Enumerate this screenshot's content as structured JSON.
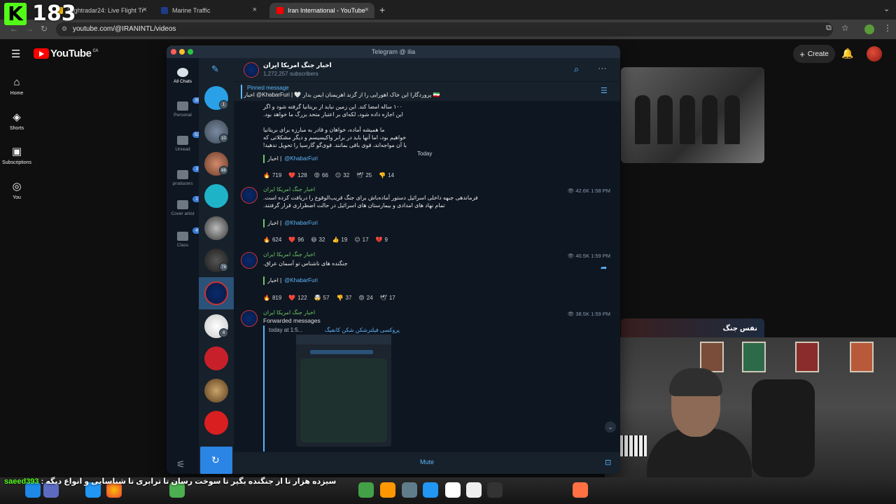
{
  "stream": {
    "kick_letter": "K",
    "viewer_count": "183"
  },
  "browser": {
    "tabs": [
      {
        "label": "Flightradar24: Live Flight Tra",
        "active": false
      },
      {
        "label": "Marine Traffic",
        "active": false
      },
      {
        "label": "Iran International - YouTube",
        "active": true
      }
    ],
    "new_tab": "+",
    "url": "youtube.com/@IRANINTL/videos"
  },
  "youtube": {
    "logo": "YouTube",
    "country": "CA",
    "create_label": "Create",
    "nav": [
      {
        "label": "Home",
        "icon": "home-icon"
      },
      {
        "label": "Shorts",
        "icon": "shorts-icon"
      },
      {
        "label": "Subscriptions",
        "icon": "subscriptions-icon"
      },
      {
        "label": "You",
        "icon": "you-icon"
      }
    ],
    "thumb2_title": "نفس جنگ"
  },
  "telegram": {
    "window_title": "Telegram @ ilia",
    "folders": [
      {
        "label": "All Chats",
        "badge": ""
      },
      {
        "label": "Personal",
        "badge": "395"
      },
      {
        "label": "Unread",
        "badge": "535"
      },
      {
        "label": "producers",
        "badge": "3"
      },
      {
        "label": "Cover artist",
        "badge": "1"
      },
      {
        "label": "Class",
        "badge": "4"
      }
    ],
    "chat_badges": [
      "1",
      "10",
      "88",
      "78",
      "4"
    ],
    "channel": {
      "title": "اخبار جنگ امریکا ایران",
      "subscribers": "1,272,257 subscribers"
    },
    "pinned": {
      "label": "Pinned message",
      "text": "🇮🇷 پروردگارا این خاک اهورایی را از گزند اهریمنان ایمن بدار 🤍 | KhabarFuri@ اخبار"
    },
    "date_separator": "Today",
    "messages": [
      {
        "text_lines": [
          "۱۰۰ ساله امضا کند. این زمین نباید از بریتانیا گرفته شود و اگر",
          "این اجازه داده شود، لکه‌ای بر اعتبار متحد بزرگ ما خواهد بود.",
          "",
          "ما همیشه آماده، خواهان و قادر به مبارزه برای بریتانیا",
          "خواهیم بود، اما آنها باید در برابر واکیسیسم و دیگر مشکلاتی که",
          "با آن مواجه‌اند، قوی باقی بمانند. قوی‌گو گارسیا را تحویل ندهید!"
        ],
        "signature": {
          "label": "اخبار |",
          "handle": "@KhabarFuri"
        },
        "reactions": [
          {
            "emoji": "🔥",
            "count": "719"
          },
          {
            "emoji": "❤️",
            "count": "128"
          },
          {
            "emoji": "😡",
            "count": "66"
          },
          {
            "emoji": "😐",
            "count": "32"
          },
          {
            "emoji": "🕊",
            "count": "25"
          },
          {
            "emoji": "👎",
            "count": "14"
          }
        ]
      },
      {
        "author": "اخبار جنگ امریکا ایران",
        "views": "42.6K",
        "time": "1:58 PM",
        "text_lines": [
          "فرماندهی جبهه داخلی اسرائیل دستور آماده‌باش برای جنگ قریب‌الوقوع را دریافت کرده است.",
          "تمام نهاد های امدادی و بیمارستان های اسرائیل در حالت اضطراری قرار گرفتند."
        ],
        "signature": {
          "label": "اخبار |",
          "handle": "@KhabarFuri"
        },
        "reactions": [
          {
            "emoji": "🔥",
            "count": "624"
          },
          {
            "emoji": "❤️",
            "count": "96"
          },
          {
            "emoji": "😄",
            "count": "32"
          },
          {
            "emoji": "👍",
            "count": "19"
          },
          {
            "emoji": "😐",
            "count": "17"
          },
          {
            "emoji": "💔",
            "count": "9"
          }
        ]
      },
      {
        "author": "اخبار جنگ امریکا ایران",
        "views": "40.5K",
        "time": "1:59 PM",
        "text_lines": [
          "جنگنده های ناشناس تو آسمان عراق."
        ],
        "signature": {
          "label": "اخبار |",
          "handle": "@KhabarFuri"
        },
        "reactions": [
          {
            "emoji": "🔥",
            "count": "819"
          },
          {
            "emoji": "❤️",
            "count": "122"
          },
          {
            "emoji": "🤯",
            "count": "57"
          },
          {
            "emoji": "👎",
            "count": "37"
          },
          {
            "emoji": "😡",
            "count": "24"
          },
          {
            "emoji": "🕊",
            "count": "17"
          }
        ]
      },
      {
        "author": "اخبار جنگ امریکا ایران",
        "views": "38.5K",
        "time": "1:59 PM",
        "forwarded_label": "Forwarded messages",
        "forwarded_time": "today at 1:5...",
        "forwarded_name": "پروکسی فیلترشکن شکن کانفیگ"
      }
    ],
    "mute_label": "Mute"
  },
  "chat_overlay": {
    "user": "saeed393",
    "message": ": سیزده هزار تا از جنگنده بگیر تا سوخت رسان تا ترابری تا شناسایی و انواع دیگه"
  },
  "colors": {
    "kick_green": "#53fc18",
    "yt_red": "#ff0000",
    "tg_accent": "#5eb5f7",
    "tg_author": "#6ec765",
    "tg_bg": "#0e1621"
  }
}
